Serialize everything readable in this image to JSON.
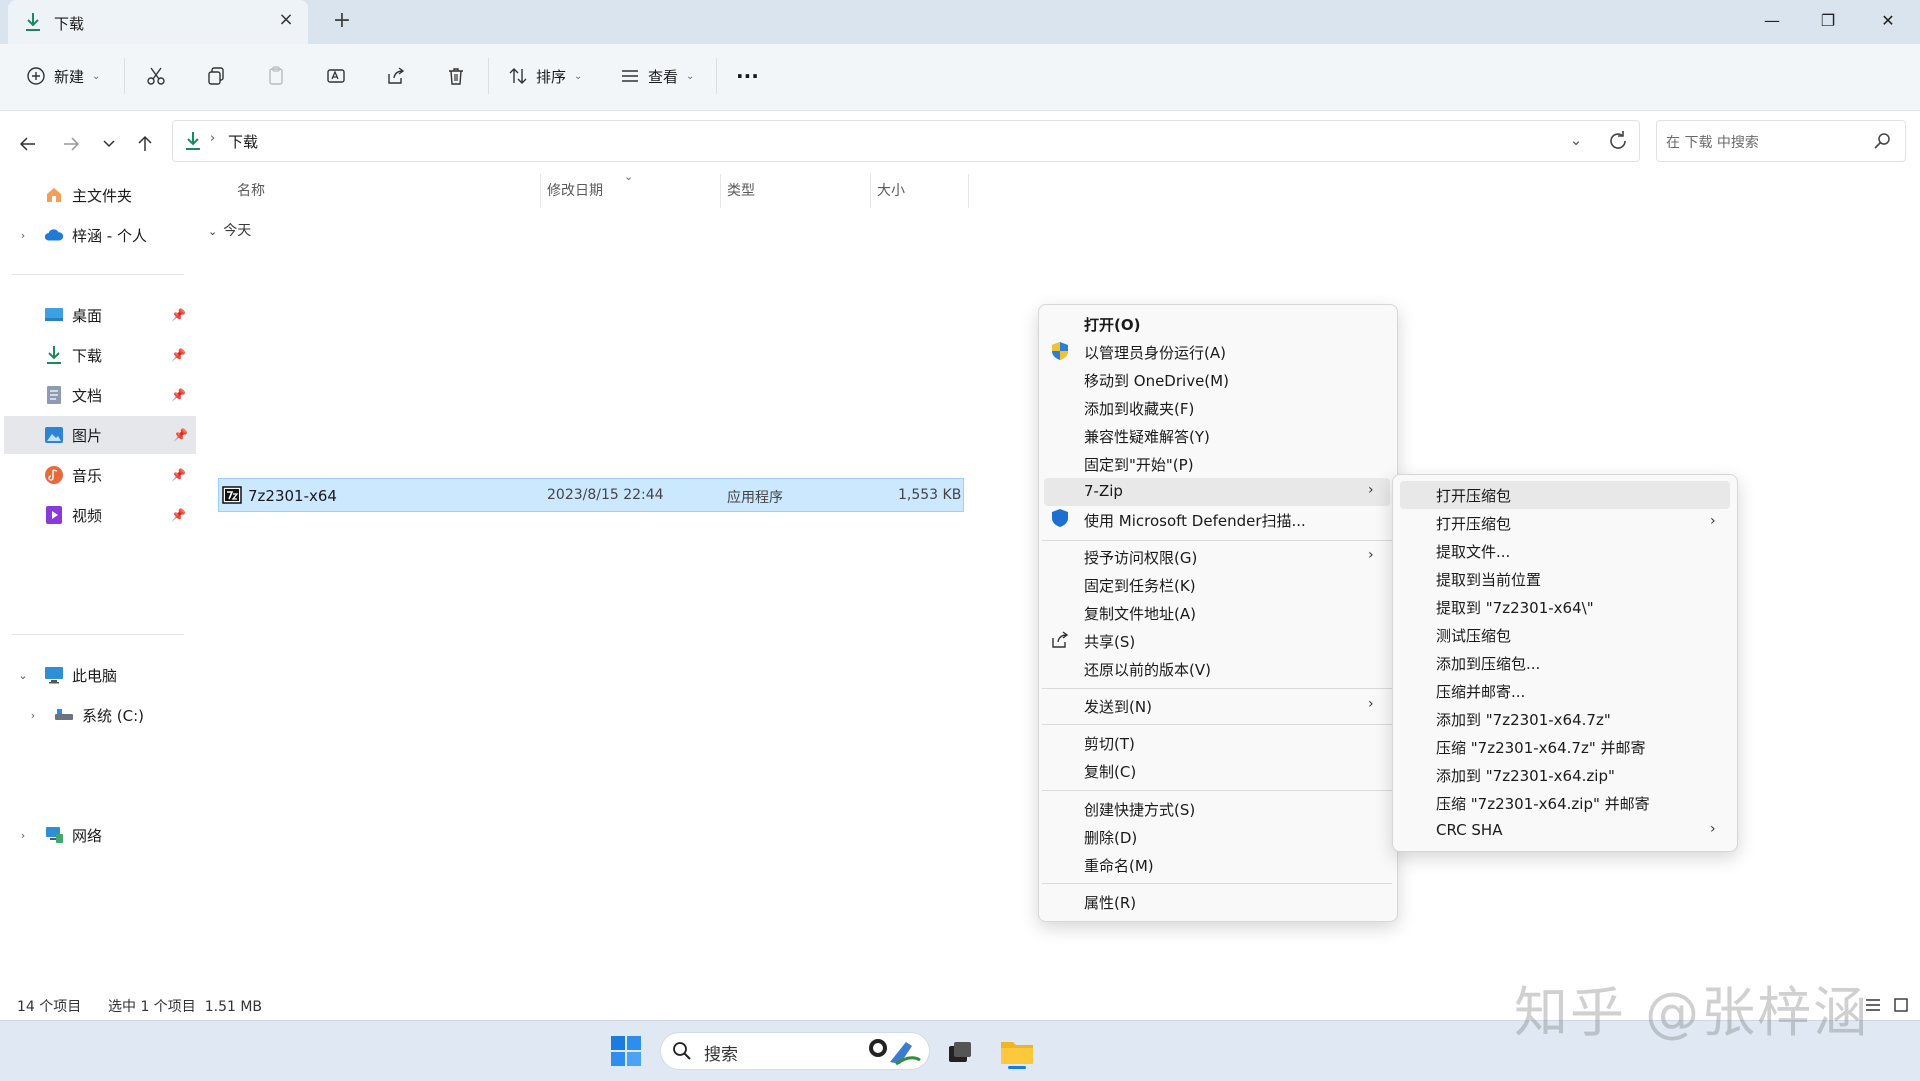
{
  "window": {
    "tab_title": "下载",
    "new_tab": "+",
    "close_tab": "×",
    "minimize": "—",
    "maximize": "❐",
    "close": "✕"
  },
  "toolbar": {
    "new_label": "新建",
    "sort_label": "排序",
    "view_label": "查看",
    "more_label": "···"
  },
  "address": {
    "path": "下载",
    "search_placeholder": "在 下载 中搜索"
  },
  "sidebar": {
    "items": [
      {
        "label": "主文件夹"
      },
      {
        "label": "梓涵 - 个人"
      },
      {
        "label": "桌面"
      },
      {
        "label": "下载"
      },
      {
        "label": "文档"
      },
      {
        "label": "图片"
      },
      {
        "label": "音乐"
      },
      {
        "label": "视频"
      },
      {
        "label": "此电脑"
      },
      {
        "label": "系统 (C:)"
      },
      {
        "label": "网络"
      }
    ]
  },
  "columns": {
    "name": "名称",
    "date": "修改日期",
    "type": "类型",
    "size": "大小"
  },
  "group": "今天",
  "file": {
    "name": "7z2301-x64",
    "date": "2023/8/15 22:44",
    "type": "应用程序",
    "size": "1,553 KB"
  },
  "context_menu": {
    "items": [
      "打开(O)",
      "以管理员身份运行(A)",
      "移动到 OneDrive(M)",
      "添加到收藏夹(F)",
      "兼容性疑难解答(Y)",
      "固定到\"开始\"(P)",
      "7-Zip",
      "使用 Microsoft Defender扫描...",
      "授予访问权限(G)",
      "固定到任务栏(K)",
      "复制文件地址(A)",
      "共享(S)",
      "还原以前的版本(V)",
      "发送到(N)",
      "剪切(T)",
      "复制(C)",
      "创建快捷方式(S)",
      "删除(D)",
      "重命名(M)",
      "属性(R)"
    ]
  },
  "submenu": {
    "items": [
      "打开压缩包",
      "打开压缩包",
      "提取文件...",
      "提取到当前位置",
      "提取到 \"7z2301-x64\\\"",
      "测试压缩包",
      "添加到压缩包...",
      "压缩并邮寄...",
      "添加到 \"7z2301-x64.7z\"",
      "压缩 \"7z2301-x64.7z\" 并邮寄",
      "添加到 \"7z2301-x64.zip\"",
      "压缩 \"7z2301-x64.zip\" 并邮寄",
      "CRC SHA"
    ]
  },
  "status": {
    "count": "14 个项目",
    "selection": "选中 1 个项目  1.51 MB"
  },
  "taskbar": {
    "search_placeholder": "搜索"
  },
  "watermark": "知乎 @张梓涵"
}
